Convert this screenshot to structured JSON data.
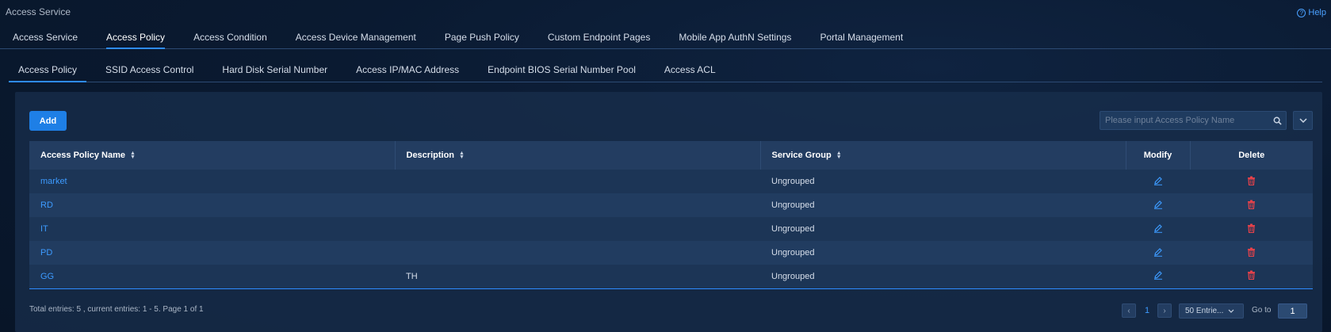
{
  "breadcrumb": "Access Service",
  "help": {
    "label": "Help"
  },
  "primary_tabs": [
    {
      "label": "Access Service",
      "active": false
    },
    {
      "label": "Access Policy",
      "active": true
    },
    {
      "label": "Access Condition",
      "active": false
    },
    {
      "label": "Access Device Management",
      "active": false
    },
    {
      "label": "Page Push Policy",
      "active": false
    },
    {
      "label": "Custom Endpoint Pages",
      "active": false
    },
    {
      "label": "Mobile App AuthN Settings",
      "active": false
    },
    {
      "label": "Portal Management",
      "active": false
    }
  ],
  "secondary_tabs": [
    {
      "label": "Access Policy",
      "active": true
    },
    {
      "label": "SSID Access Control",
      "active": false
    },
    {
      "label": "Hard Disk Serial Number",
      "active": false
    },
    {
      "label": "Access IP/MAC Address",
      "active": false
    },
    {
      "label": "Endpoint BIOS Serial Number Pool",
      "active": false
    },
    {
      "label": "Access ACL",
      "active": false
    }
  ],
  "toolbar": {
    "add_label": "Add",
    "search_placeholder": "Please input Access Policy Name"
  },
  "table": {
    "columns": [
      "Access Policy Name",
      "Description",
      "Service Group",
      "Modify",
      "Delete"
    ],
    "rows": [
      {
        "name": "market",
        "description": "",
        "service_group": "Ungrouped"
      },
      {
        "name": "RD",
        "description": "",
        "service_group": "Ungrouped"
      },
      {
        "name": "IT",
        "description": "",
        "service_group": "Ungrouped"
      },
      {
        "name": "PD",
        "description": "",
        "service_group": "Ungrouped"
      },
      {
        "name": "GG",
        "description": "TH",
        "service_group": "Ungrouped"
      }
    ]
  },
  "footer": {
    "summary": "Total entries: 5 , current entries: 1 - 5. Page 1 of 1",
    "current_page": "1",
    "per_page": "50 Entrie...",
    "goto_label": "Go to",
    "goto_value": "1"
  },
  "colors": {
    "accent": "#2e8bff",
    "link": "#3d9bff",
    "delete": "#e8424a",
    "background": "#0a1a31"
  }
}
